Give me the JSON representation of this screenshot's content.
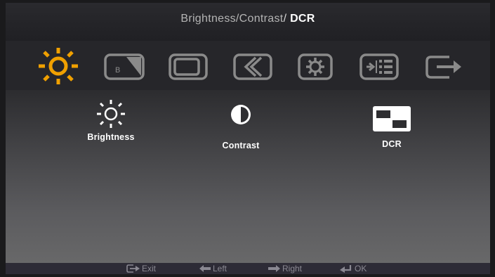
{
  "header": {
    "breadcrumb_parent": "Brightness/Contrast",
    "separator": "/",
    "breadcrumb_current": "DCR"
  },
  "tabs": [
    {
      "icon": "sun-icon",
      "active": true
    },
    {
      "icon": "image-setup-icon",
      "label": "B",
      "active": false
    },
    {
      "icon": "image-properties-icon",
      "active": false
    },
    {
      "icon": "options-icon",
      "active": false
    },
    {
      "icon": "settings-gear-icon",
      "active": false
    },
    {
      "icon": "input-signal-icon",
      "active": false
    },
    {
      "icon": "exit-icon",
      "active": false
    }
  ],
  "items": [
    {
      "label": "Brightness",
      "icon": "sun-icon"
    },
    {
      "label": "Contrast",
      "icon": "half-circle-icon"
    },
    {
      "label": "DCR",
      "icon": "dcr-icon"
    }
  ],
  "footer": {
    "exit": "Exit",
    "left": "Left",
    "right": "Right",
    "ok": "OK"
  },
  "colors": {
    "accent": "#f0a000",
    "tab_icon": "#8a8a8a",
    "text": "#ffffff",
    "footer_text": "#8a8892"
  }
}
